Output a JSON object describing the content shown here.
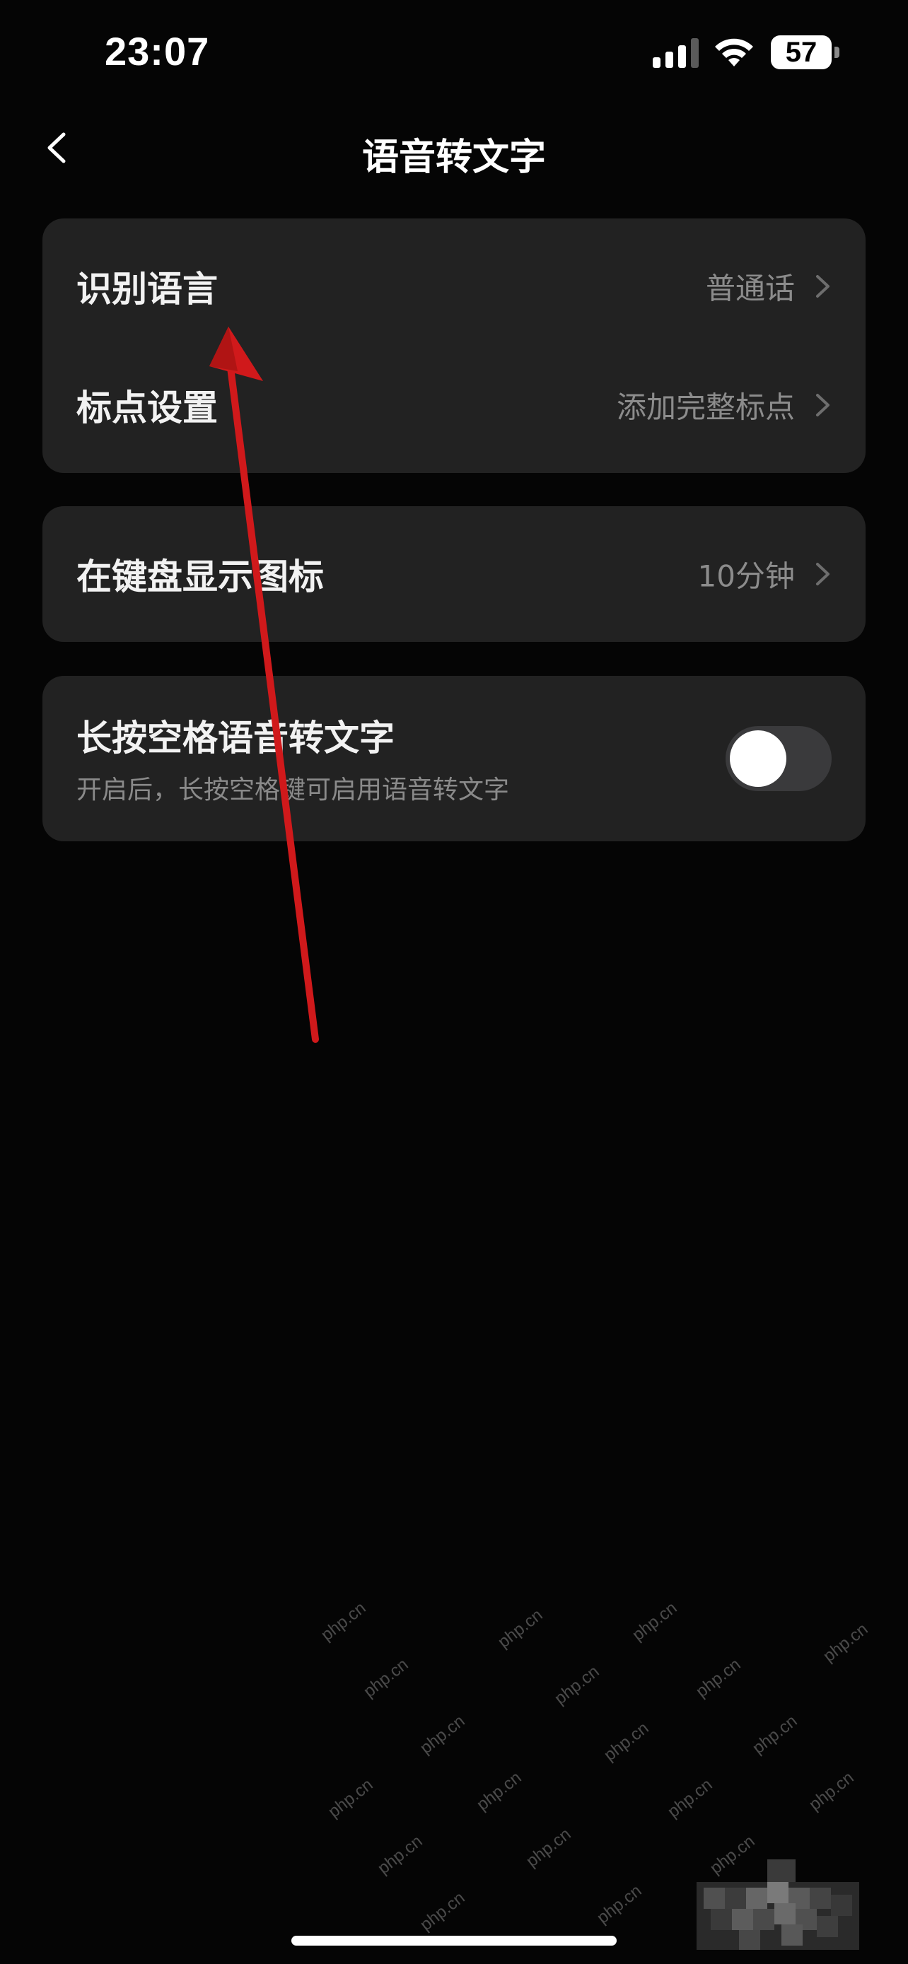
{
  "status_bar": {
    "time": "23:07",
    "battery": "57",
    "icons": [
      "signal-icon",
      "wifi-icon",
      "battery-icon"
    ]
  },
  "nav": {
    "title": "语音转文字",
    "back_icon": "chevron-left-icon"
  },
  "settings": {
    "language": {
      "label": "识别语言",
      "value": "普通话"
    },
    "punctuation": {
      "label": "标点设置",
      "value": "添加完整标点"
    },
    "keyboard_icon": {
      "label": "在键盘显示图标",
      "value": "10分钟"
    },
    "long_press": {
      "label": "长按空格语音转文字",
      "description": "开启后，长按空格键可启用语音转文字",
      "enabled": false
    }
  },
  "annotation": {
    "color": "#d0191b"
  },
  "watermark": {
    "text": "php.cn"
  },
  "colors": {
    "background": "#050505",
    "card": "#222222",
    "secondary_text": "#8c8c8c",
    "toggle_off": "#3a3a3c"
  }
}
